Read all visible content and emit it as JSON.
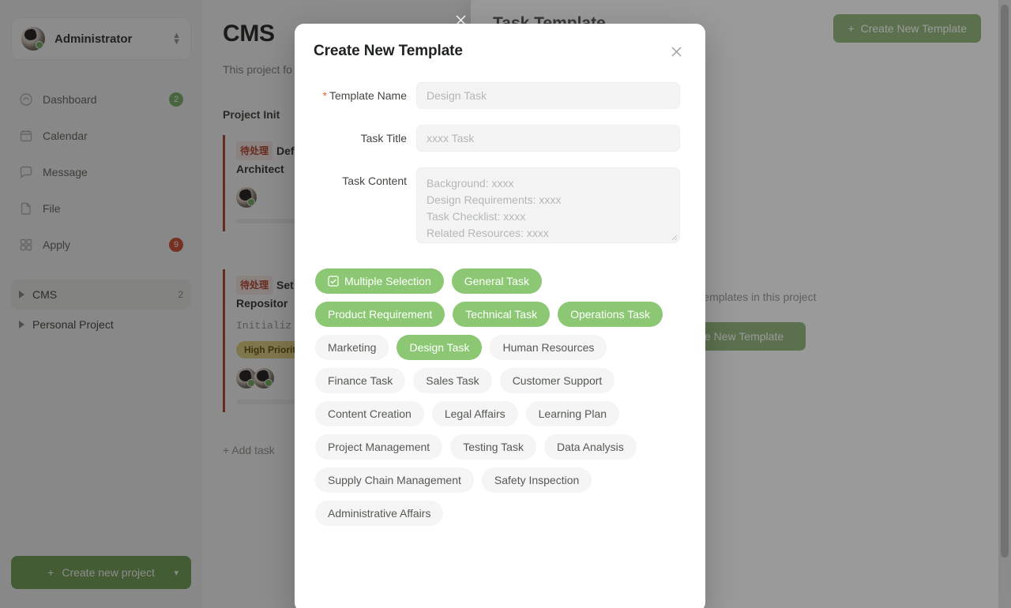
{
  "sidebar": {
    "user": {
      "name": "Administrator",
      "avatar_icon": "user-avatar",
      "stepper_icon": "chevron-up-down-icon"
    },
    "items": [
      {
        "label": "Dashboard",
        "icon": "dashboard-icon",
        "badge": "2",
        "badge_color": "#86b971"
      },
      {
        "label": "Calendar",
        "icon": "calendar-icon",
        "badge": "",
        "badge_color": ""
      },
      {
        "label": "Message",
        "icon": "message-icon",
        "badge": "",
        "badge_color": ""
      },
      {
        "label": "File",
        "icon": "file-icon",
        "badge": "",
        "badge_color": ""
      },
      {
        "label": "Apply",
        "icon": "grid-icon",
        "badge": "9",
        "badge_color": "#d9593f"
      }
    ],
    "projects": [
      {
        "label": "CMS",
        "count": "2",
        "active": true
      },
      {
        "label": "Personal Project",
        "count": "",
        "active": false
      }
    ],
    "create_project_label": "Create new project",
    "create_project_icon": "plus-icon",
    "create_project_chevron": "chevron-down-icon"
  },
  "main": {
    "page_title": "CMS",
    "page_desc": "This project fo\nmanagement",
    "column_title": "Project Init",
    "cards": [
      {
        "status_badge": "待处理",
        "title_line1": "Def",
        "title_line2": "Architect",
        "sub": "",
        "priority": "",
        "avatars": 1
      },
      {
        "status_badge": "待处理",
        "title_line1": "Set",
        "title_line2": "Repositor",
        "sub": "Initializ",
        "priority": "High Priorit",
        "avatars": 2
      }
    ],
    "add_task_label": "+ Add task"
  },
  "drawer": {
    "title": "Task Template",
    "create_button_label": "Create New Template",
    "create_button_icon": "plus-icon",
    "empty_text": "y no task templates in this project",
    "empty_button_label": "reate New Template",
    "close_icon": "close-icon"
  },
  "modal": {
    "title": "Create New Template",
    "close_icon": "close-icon",
    "fields": [
      {
        "label": "Template Name",
        "required": true,
        "value": "",
        "placeholder": "Design Task",
        "type": "text"
      },
      {
        "label": "Task Title",
        "required": false,
        "value": "",
        "placeholder": "xxxx Task",
        "type": "text"
      }
    ],
    "textarea": {
      "label": "Task Content",
      "required": false,
      "value": "",
      "placeholder_lines": [
        "Background: xxxx",
        "Design Requirements: xxxx",
        "Task Checklist: xxxx",
        "Related Resources: xxxx"
      ],
      "resize_icon": "resize-grip-icon"
    },
    "chips": [
      {
        "label": "Multiple Selection",
        "selected": true,
        "icon": "checkbox-checked-icon"
      },
      {
        "label": "General Task",
        "selected": true,
        "icon": ""
      },
      {
        "label": "Product Requirement",
        "selected": true,
        "icon": ""
      },
      {
        "label": "Technical Task",
        "selected": true,
        "icon": ""
      },
      {
        "label": "Operations Task",
        "selected": true,
        "icon": ""
      },
      {
        "label": "Marketing",
        "selected": false,
        "icon": ""
      },
      {
        "label": "Design Task",
        "selected": true,
        "icon": ""
      },
      {
        "label": "Human Resources",
        "selected": false,
        "icon": ""
      },
      {
        "label": "Finance Task",
        "selected": false,
        "icon": ""
      },
      {
        "label": "Sales Task",
        "selected": false,
        "icon": ""
      },
      {
        "label": "Customer Support",
        "selected": false,
        "icon": ""
      },
      {
        "label": "Content Creation",
        "selected": false,
        "icon": ""
      },
      {
        "label": "Legal Affairs",
        "selected": false,
        "icon": ""
      },
      {
        "label": "Learning Plan",
        "selected": false,
        "icon": ""
      },
      {
        "label": "Project Management",
        "selected": false,
        "icon": ""
      },
      {
        "label": "Testing Task",
        "selected": false,
        "icon": ""
      },
      {
        "label": "Data Analysis",
        "selected": false,
        "icon": ""
      },
      {
        "label": "Supply Chain Management",
        "selected": false,
        "icon": ""
      },
      {
        "label": "Safety Inspection",
        "selected": false,
        "icon": ""
      },
      {
        "label": "Administrative Affairs",
        "selected": false,
        "icon": ""
      }
    ]
  },
  "colors": {
    "accent_green": "#7aa85f",
    "chip_green": "#8cc873",
    "required_red": "#f05a36",
    "badge_red": "#d9593f"
  }
}
